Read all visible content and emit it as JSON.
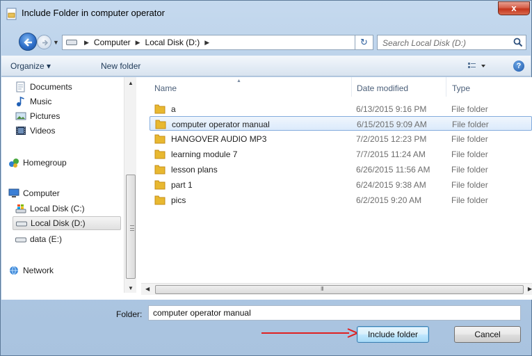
{
  "window": {
    "title": "Include Folder in computer operator",
    "close_label": "x"
  },
  "address": {
    "crumbs": [
      "Computer",
      "Local Disk (D:)"
    ],
    "search_placeholder": "Search Local Disk (D:)"
  },
  "toolbar": {
    "organize_label": "Organize ▾",
    "new_folder_label": "New folder",
    "help_label": "?"
  },
  "nav": {
    "items": [
      {
        "label": "Documents",
        "icon": "documents-icon"
      },
      {
        "label": "Music",
        "icon": "music-icon"
      },
      {
        "label": "Pictures",
        "icon": "pictures-icon"
      },
      {
        "label": "Videos",
        "icon": "videos-icon"
      },
      {
        "label": "Homegroup",
        "icon": "homegroup-icon"
      },
      {
        "label": "Computer",
        "icon": "computer-icon"
      },
      {
        "label": "Local Disk (C:)",
        "icon": "system-drive-icon"
      },
      {
        "label": "Local Disk (D:)",
        "icon": "drive-icon",
        "selected": true
      },
      {
        "label": "data (E:)",
        "icon": "drive-icon"
      },
      {
        "label": "Network",
        "icon": "network-icon"
      }
    ]
  },
  "files": {
    "columns": {
      "name": "Name",
      "date": "Date modified",
      "type": "Type"
    },
    "rows": [
      {
        "name": "a",
        "date": "6/13/2015 9:16 PM",
        "type": "File folder"
      },
      {
        "name": "computer operator manual",
        "date": "6/15/2015 9:09 AM",
        "type": "File folder",
        "selected": true
      },
      {
        "name": "HANGOVER AUDIO MP3",
        "date": "7/2/2015 12:23 PM",
        "type": "File folder"
      },
      {
        "name": "learning module 7",
        "date": "7/7/2015 11:24 AM",
        "type": "File folder"
      },
      {
        "name": "lesson plans",
        "date": "6/26/2015 11:56 AM",
        "type": "File folder"
      },
      {
        "name": "part 1",
        "date": "6/24/2015 9:38 AM",
        "type": "File folder"
      },
      {
        "name": "pics",
        "date": "6/2/2015 9:20 AM",
        "type": "File folder"
      }
    ]
  },
  "footer": {
    "folder_label": "Folder:",
    "folder_value": "computer operator manual",
    "include_button": "Include folder",
    "cancel_button": "Cancel"
  },
  "colors": {
    "annotation_arrow": "#e02020",
    "folder_yellow": "#e8b830",
    "selection_border": "#84acdd"
  }
}
